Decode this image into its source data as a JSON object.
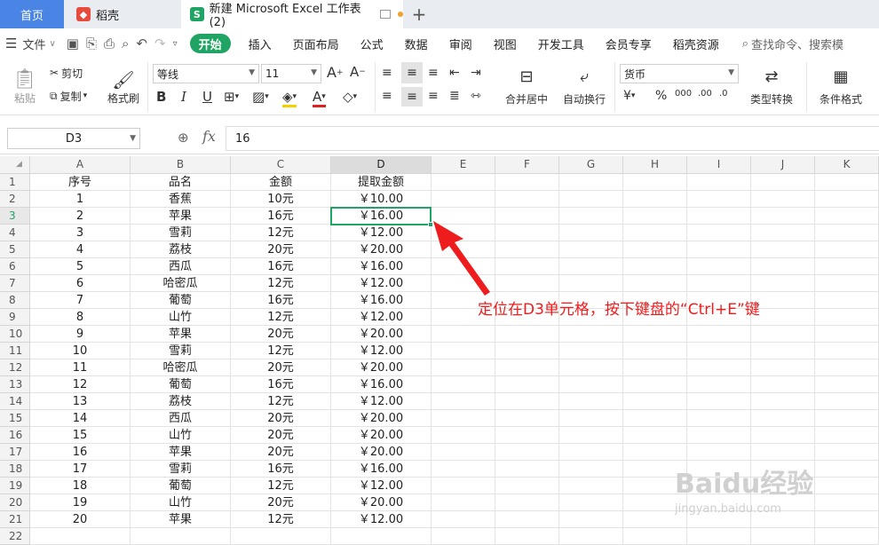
{
  "tabs": {
    "home": "首页",
    "daoke": "稻壳",
    "excel": "新建 Microsoft Excel 工作表 (2)",
    "add": "+"
  },
  "menu": {
    "file": "文件",
    "items": [
      "开始",
      "插入",
      "页面布局",
      "公式",
      "数据",
      "审阅",
      "视图",
      "开发工具",
      "会员专享",
      "稻壳资源"
    ],
    "search": "查找命令、搜索模"
  },
  "ribbon": {
    "paste": "粘贴",
    "cut": "剪切",
    "copy": "复制",
    "format_painter": "格式刷",
    "font": "等线",
    "size": "11",
    "merge": "合并居中",
    "wrap": "自动换行",
    "number_format": "货币",
    "type_convert": "类型转换",
    "cond_format": "条件格式"
  },
  "formula_bar": {
    "name_box": "D3",
    "fx": "fx",
    "value": "16"
  },
  "columns": [
    "A",
    "B",
    "C",
    "D",
    "E",
    "F",
    "G",
    "H",
    "I",
    "J",
    "K"
  ],
  "header_row": [
    "序号",
    "品名",
    "金额",
    "提取金额"
  ],
  "rows": [
    [
      "1",
      "香蕉",
      "10元",
      "￥10.00"
    ],
    [
      "2",
      "苹果",
      "16元",
      "￥16.00"
    ],
    [
      "3",
      "雪莉",
      "12元",
      "￥12.00"
    ],
    [
      "4",
      "荔枝",
      "20元",
      "￥20.00"
    ],
    [
      "5",
      "西瓜",
      "16元",
      "￥16.00"
    ],
    [
      "6",
      "哈密瓜",
      "12元",
      "￥12.00"
    ],
    [
      "7",
      "葡萄",
      "16元",
      "￥16.00"
    ],
    [
      "8",
      "山竹",
      "12元",
      "￥12.00"
    ],
    [
      "9",
      "苹果",
      "20元",
      "￥20.00"
    ],
    [
      "10",
      "雪莉",
      "12元",
      "￥12.00"
    ],
    [
      "11",
      "哈密瓜",
      "20元",
      "￥20.00"
    ],
    [
      "12",
      "葡萄",
      "16元",
      "￥16.00"
    ],
    [
      "13",
      "荔枝",
      "12元",
      "￥12.00"
    ],
    [
      "14",
      "西瓜",
      "20元",
      "￥20.00"
    ],
    [
      "15",
      "山竹",
      "20元",
      "￥20.00"
    ],
    [
      "16",
      "苹果",
      "20元",
      "￥20.00"
    ],
    [
      "17",
      "雪莉",
      "16元",
      "￥16.00"
    ],
    [
      "18",
      "葡萄",
      "12元",
      "￥12.00"
    ],
    [
      "19",
      "山竹",
      "20元",
      "￥20.00"
    ],
    [
      "20",
      "苹果",
      "12元",
      "￥12.00"
    ]
  ],
  "row_count": 22,
  "selected_cell": {
    "col": "D",
    "row": 3
  },
  "annotation": "定位在D3单元格，按下键盘的“Ctrl+E”键",
  "watermark": {
    "main": "Baidu经验",
    "sub": "jingyan.baidu.com"
  },
  "colors": {
    "accent": "#1fa463",
    "tab_active": "#4a84e5",
    "annotation": "#ee1c1c"
  }
}
